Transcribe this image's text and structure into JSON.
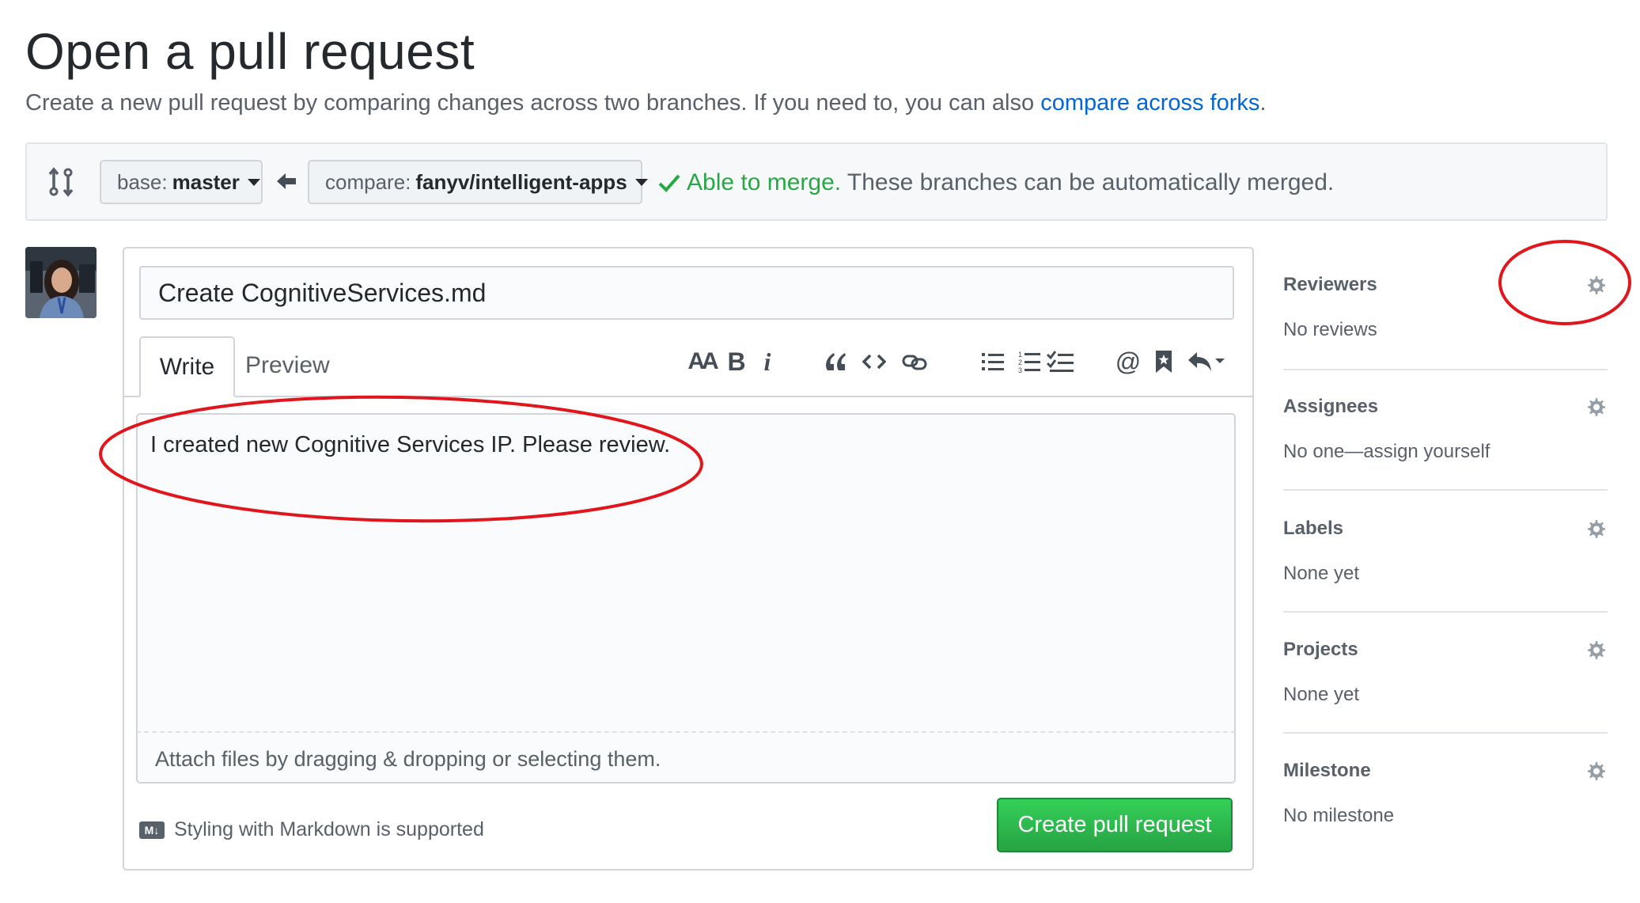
{
  "header": {
    "title": "Open a pull request",
    "subtitle_text": "Create a new pull request by comparing changes across two branches. If you need to, you can also ",
    "subtitle_link": "compare across forks",
    "subtitle_end": "."
  },
  "range": {
    "base_prefix": "base:",
    "base_value": "master",
    "compare_prefix": "compare:",
    "compare_value": "fanyv/intelligent-apps",
    "merge_ok": "Able to merge.",
    "merge_msg": " These branches can be automatically merged."
  },
  "form": {
    "title_value": "Create CognitiveServices.md",
    "tab_write": "Write",
    "tab_preview": "Preview",
    "body_text": "I created new Cognitive Services IP. Please review.",
    "attach_text": "Attach files by dragging & dropping or selecting them.",
    "markdown_note": "Styling with Markdown is supported",
    "markdown_badge": "M↓",
    "create_button": "Create pull request",
    "toolbar": {
      "header": "AA",
      "bold": "B",
      "italic": "i",
      "mention": "@"
    }
  },
  "sidebar": {
    "reviewers": {
      "label": "Reviewers",
      "value": "No reviews"
    },
    "assignees": {
      "label": "Assignees",
      "value": "No one—assign yourself"
    },
    "labels": {
      "label": "Labels",
      "value": "None yet"
    },
    "projects": {
      "label": "Projects",
      "value": "None yet"
    },
    "milestone": {
      "label": "Milestone",
      "value": "No milestone"
    }
  },
  "colors": {
    "link": "#0366d6",
    "success": "#28a745",
    "annotation": "#e0161c"
  }
}
